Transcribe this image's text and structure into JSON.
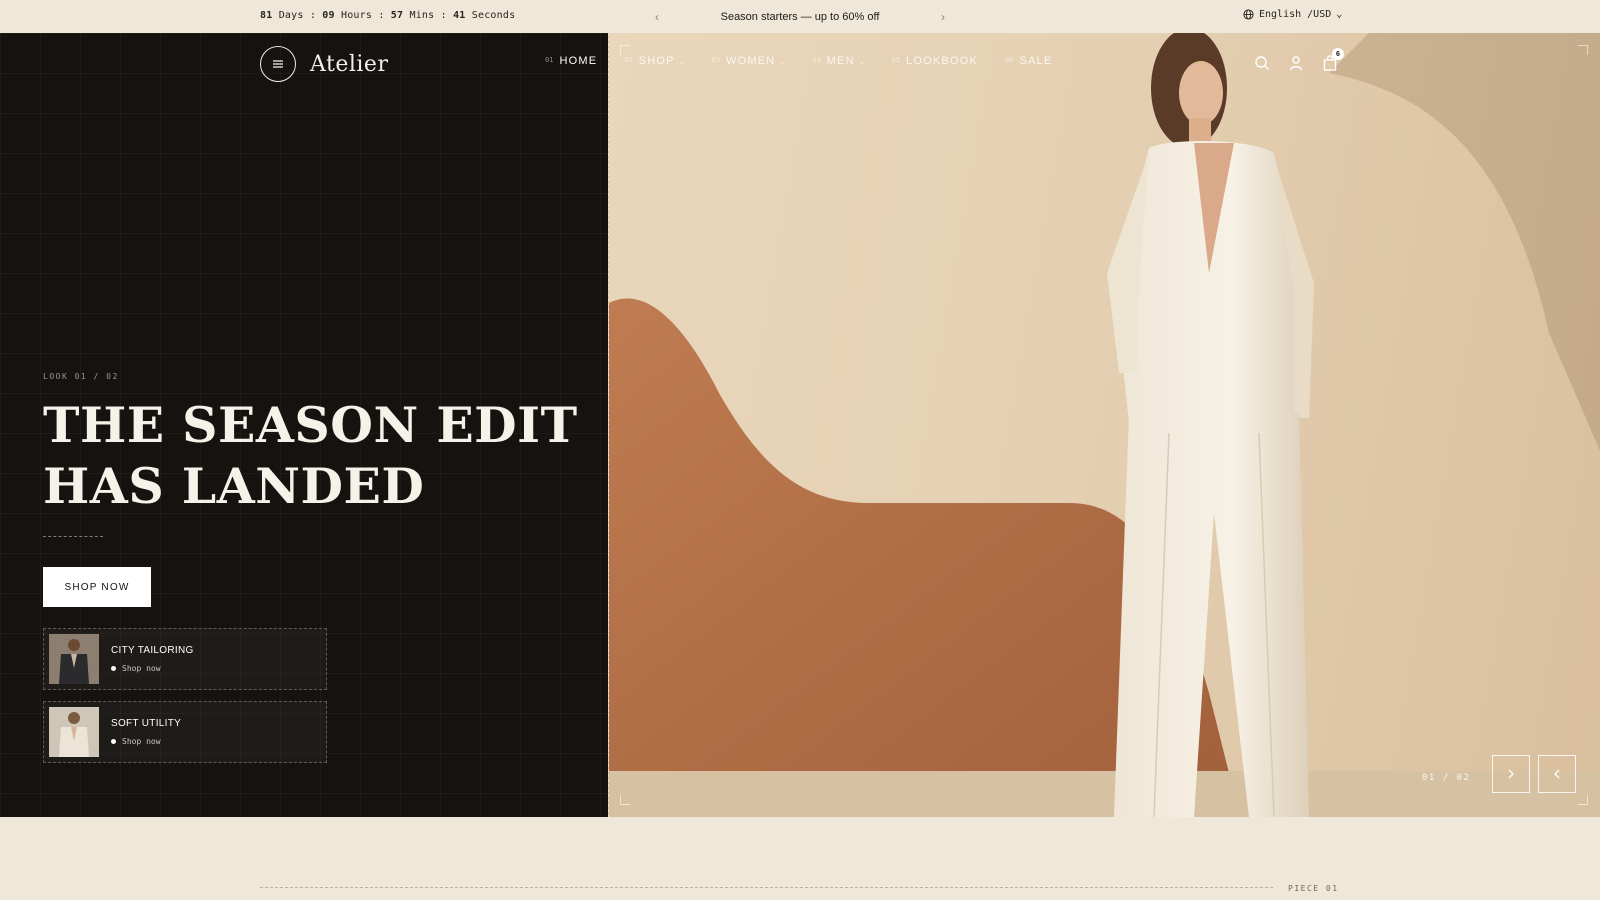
{
  "topbar": {
    "countdown": {
      "days": "81",
      "days_label": "Days",
      "hours": "09",
      "hours_label": "Hours",
      "mins": "57",
      "mins_label": "Mins",
      "secs": "41",
      "secs_label": "Seconds",
      "sep": ":"
    },
    "promo": {
      "message": "Season starters — up to 60% off",
      "prev": "‹",
      "next": "›"
    },
    "locale": {
      "label": "English /USD",
      "caret": "⌄"
    }
  },
  "brand": {
    "name": "Atelier"
  },
  "nav": [
    {
      "num": "01",
      "label": "HOME",
      "caret": ""
    },
    {
      "num": "02",
      "label": "SHOP",
      "caret": "⌄"
    },
    {
      "num": "03",
      "label": "WOMEN",
      "caret": "⌄"
    },
    {
      "num": "04",
      "label": "MEN",
      "caret": "⌄"
    },
    {
      "num": "05",
      "label": "LOOKBOOK",
      "caret": ""
    },
    {
      "num": "06",
      "label": "SALE",
      "caret": ""
    }
  ],
  "header_icons": {
    "cart_count": "6"
  },
  "hero": {
    "look_label": "LOOK 01 / 02",
    "headline_line1": "THE SEASON EDIT",
    "headline_line2": "HAS LANDED",
    "cta": "SHOP NOW",
    "categories": [
      {
        "title": "CITY TAILORING",
        "cta": "Shop now"
      },
      {
        "title": "SOFT UTILITY",
        "cta": "Shop now"
      }
    ],
    "slide_counter": "01 / 02"
  },
  "next_section": {
    "label": "PIECE 01"
  },
  "colors": {
    "dark_panel": "#15120f",
    "cream": "#efe8d9",
    "sand": "#e5d0b3",
    "terracotta": "#b8754e"
  }
}
